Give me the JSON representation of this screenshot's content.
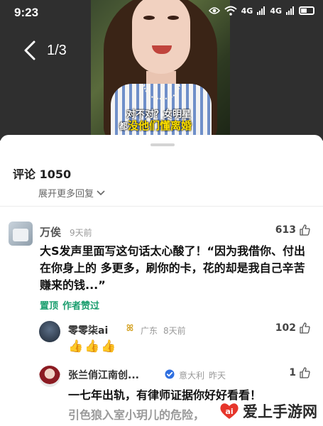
{
  "status_bar": {
    "time": "9:23",
    "icons": [
      "eye-icon",
      "wifi-icon",
      "4g-signal-icon",
      "4g-signal-icon",
      "battery-icon"
    ],
    "signal_label_1": "4G",
    "signal_label_2": "4G"
  },
  "viewer": {
    "page_indicator": "1/3",
    "subtitle_line_1": "对不对？女明星",
    "subtitle_line_2_prefix": "都",
    "subtitle_line_2": "没他们懂离婚"
  },
  "comments": {
    "header": "评论 1050",
    "expand_more_label": "展开更多回复",
    "main": {
      "username": "万俟",
      "time": "9天前",
      "likes": "613",
      "text": "大S发声里面写这句话太心酸了！“因为我借你、付出在你身上的 多更多，刷你的卡，花的却是我自己辛苦赚来的钱...”",
      "pinned_label": "置顶",
      "author_liked_label": "作者赞过"
    },
    "replies": [
      {
        "username": "零零柒ai",
        "badge": "ꕤ",
        "location": "广东",
        "time": "8天前",
        "likes": "102",
        "text": "👍👍👍"
      },
      {
        "username": "张兰俏江南创...",
        "location": "意大利",
        "time": "昨天",
        "likes": "1",
        "text": "一七年出轨，有律师证据你好好看看！"
      }
    ],
    "faded_line": "引色狼入室小玥儿的危险，"
  },
  "watermark": {
    "text": "爱上手游网"
  },
  "colors": {
    "accent_green": "#1a9e6e",
    "badge_gold": "#d6a62c",
    "subtitle_yellow": "#ffe000"
  }
}
